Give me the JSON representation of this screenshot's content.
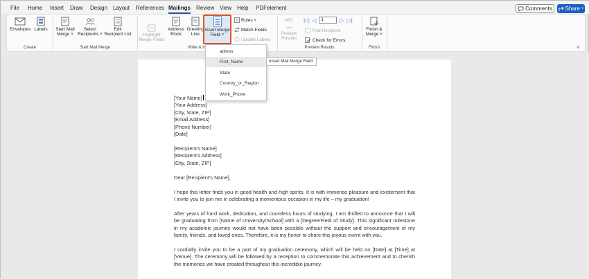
{
  "menu": {
    "tabs": [
      "File",
      "Home",
      "Insert",
      "Draw",
      "Design",
      "Layout",
      "References",
      "Mailings",
      "Review",
      "View",
      "Help",
      "PDFelement"
    ],
    "active": "Mailings",
    "comments_label": "Comments",
    "share_label": "Share"
  },
  "ribbon": {
    "create": {
      "envelopes": "Envelopes",
      "labels": "Labels",
      "group": "Create"
    },
    "start_mail_merge": {
      "start_line1": "Start Mail",
      "start_line2": "Merge ˅",
      "select_line1": "Select",
      "select_line2": "Recipients ˅",
      "edit_line1": "Edit",
      "edit_line2": "Recipient List",
      "group": "Start Mail Merge"
    },
    "write_insert": {
      "highlight_line1": "Highlight",
      "highlight_line2": "Merge Fields",
      "address_line1": "Address",
      "address_line2": "Block",
      "greeting_line1": "Greeting",
      "greeting_line2": "Line",
      "insert_line1": "Insert Merge",
      "insert_line2": "Field ˅",
      "rules": "Rules ˅",
      "match_fields": "Match Fields",
      "update_labels": "Update Labels",
      "group": "Write & Insert Fields"
    },
    "preview": {
      "preview_line1": "Preview",
      "preview_line2": "Results",
      "abc": "ABC",
      "record_value": "1",
      "find_recipient": "Find Recipient",
      "check_errors": "Check for Errors",
      "group": "Preview Results"
    },
    "finish": {
      "line1": "Finish &",
      "line2": "Merge ˅",
      "group": "Finish"
    }
  },
  "dropdown": {
    "items": [
      "adress",
      "First_Name",
      "State",
      "Country_or_Region",
      "Work_Phone"
    ],
    "hovered": "First_Name"
  },
  "tooltip": "Insert Mail Merge Field",
  "document": {
    "sender": [
      "[Your Name]",
      "[Your Address]",
      "[City, State, ZIP]",
      "[Email Address]",
      "[Phone Number]",
      "[Date]"
    ],
    "recipient": [
      "[Recipient's Name]",
      "[Recipient's Address]",
      "[City, State, ZIP]"
    ],
    "salutation": "Dear [Recipient's Name],",
    "paragraphs": [
      "I hope this letter finds you in good health and high spirits. It is with immense pleasure and excitement that I invite you to join me in celebrating a momentous occasion in my life – my graduation!",
      "After years of hard work, dedication, and countless hours of studying, I am thrilled to announce that I will be graduating from [Name of University/School] with a [Degree/Field of Study]. This significant milestone in my academic journey would not have been possible without the support and encouragement of my family, friends, and loved ones. Therefore, it is my honor to share this joyous event with you.",
      "I cordially invite you to be a part of my graduation ceremony, which will be held on [Date] at [Time] at [Venue]. The ceremony will be followed by a reception to commemorate this achievement and to cherish the memories we have created throughout this incredible journey."
    ]
  },
  "colors": {
    "accent": "#2b579a",
    "share": "#1d5fc5",
    "highlight_border": "#d9542a"
  }
}
